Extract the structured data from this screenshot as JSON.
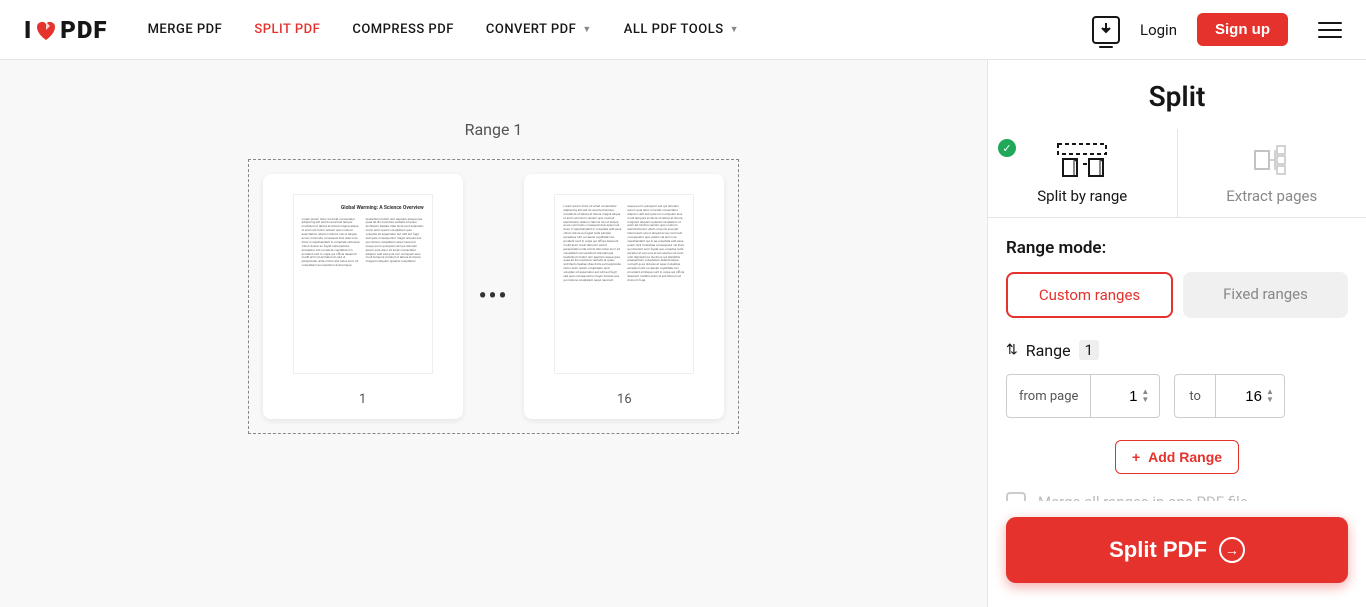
{
  "logo": {
    "pre": "I",
    "post": "PDF"
  },
  "nav": {
    "merge": "MERGE PDF",
    "split": "SPLIT PDF",
    "compress": "COMPRESS PDF",
    "convert": "CONVERT PDF",
    "all": "ALL PDF TOOLS"
  },
  "header": {
    "login": "Login",
    "signup": "Sign up"
  },
  "preview": {
    "range_title": "Range 1",
    "page_first": "1",
    "page_last": "16",
    "thumb_title": "Global Warming: A Science Overview"
  },
  "sidebar": {
    "title": "Split",
    "tab_range": "Split by range",
    "tab_extract": "Extract pages",
    "mode_label": "Range mode:",
    "mode_custom": "Custom ranges",
    "mode_fixed": "Fixed ranges",
    "range_word": "Range",
    "range_number": "1",
    "from_label": "from page",
    "from_value": "1",
    "to_label": "to",
    "to_value": "16",
    "add_range": "Add Range",
    "merge_text": "Merge all ranges in one PDF file.",
    "action": "Split PDF"
  }
}
